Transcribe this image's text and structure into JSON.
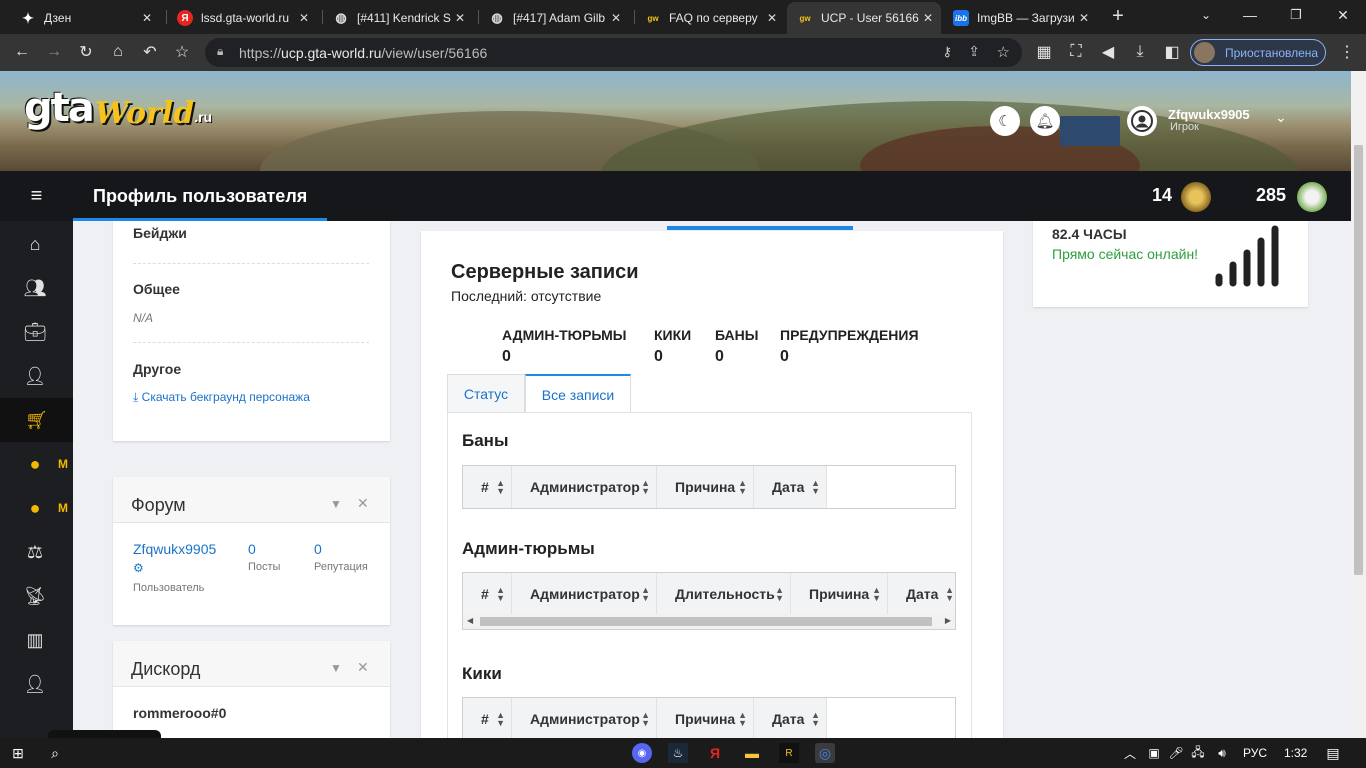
{
  "browser": {
    "tabs": [
      {
        "title": "Дзен",
        "icon": "zen-icon"
      },
      {
        "title": "lssd.gta-world.ru",
        "icon": "yandex-icon"
      },
      {
        "title": "[#411] Kendrick S",
        "icon": "globe-icon"
      },
      {
        "title": "[#417] Adam Gilb",
        "icon": "globe-icon"
      },
      {
        "title": "FAQ по серверу",
        "icon": "gta-icon"
      },
      {
        "title": "UCP - User 56166",
        "icon": "gta-icon"
      },
      {
        "title": "ImgBB — Загрузи",
        "icon": "imgbb-icon"
      }
    ],
    "url_prefix": "https://",
    "url_host": "ucp.gta-world.ru",
    "url_path": "/view/user/56166",
    "profile_status": "Приостановлена"
  },
  "site": {
    "logo_gta": "gta",
    "logo_world": "World",
    "logo_ru": ".ru",
    "user_name": "Zfqwukx9905",
    "user_role": "Игрок",
    "page_title": "Профиль пользователя",
    "counter1": "14",
    "counter2": "285"
  },
  "left_card": {
    "badges_label": "Бейджи",
    "general_label": "Общее",
    "general_value": "N/A",
    "other_label": "Другое",
    "download_link": "Скачать бекграунд персонажа"
  },
  "forum": {
    "title": "Форум",
    "username": "Zfqwukx9905",
    "role": "Пользователь",
    "posts_value": "0",
    "posts_label": "Посты",
    "rep_value": "0",
    "rep_label": "Репутация"
  },
  "discord": {
    "title": "Дискорд",
    "handle": "rommerooo#0"
  },
  "records": {
    "title": "Серверные записи",
    "last": "Последний: отсутствие",
    "stats": [
      {
        "label": "АДМИН-ТЮРЬМЫ",
        "value": "0"
      },
      {
        "label": "КИКИ",
        "value": "0"
      },
      {
        "label": "БАНЫ",
        "value": "0"
      },
      {
        "label": "ПРЕДУПРЕЖДЕНИЯ",
        "value": "0"
      }
    ],
    "tabs": [
      "Статус",
      "Все записи"
    ],
    "sections": {
      "bans": {
        "title": "Баны",
        "cols": [
          "#",
          "Администратор",
          "Причина",
          "Дата"
        ]
      },
      "jails": {
        "title": "Админ-тюрьмы",
        "cols": [
          "#",
          "Администратор",
          "Длительность",
          "Причина",
          "Дата"
        ]
      },
      "kicks": {
        "title": "Кики",
        "cols": [
          "#",
          "Администратор",
          "Причина",
          "Дата"
        ]
      }
    }
  },
  "online": {
    "hours": "82.4 ЧАСЫ",
    "status": "Прямо сейчас онлайн!"
  },
  "sidebar_labels": {
    "m1": "М",
    "m2": "М"
  },
  "taskbar": {
    "lang": "РУС",
    "time": "1:32"
  },
  "colors": {
    "accent": "#1e88e5",
    "online_green": "#2e9e3e",
    "sidebar_active": "#f5b800"
  }
}
